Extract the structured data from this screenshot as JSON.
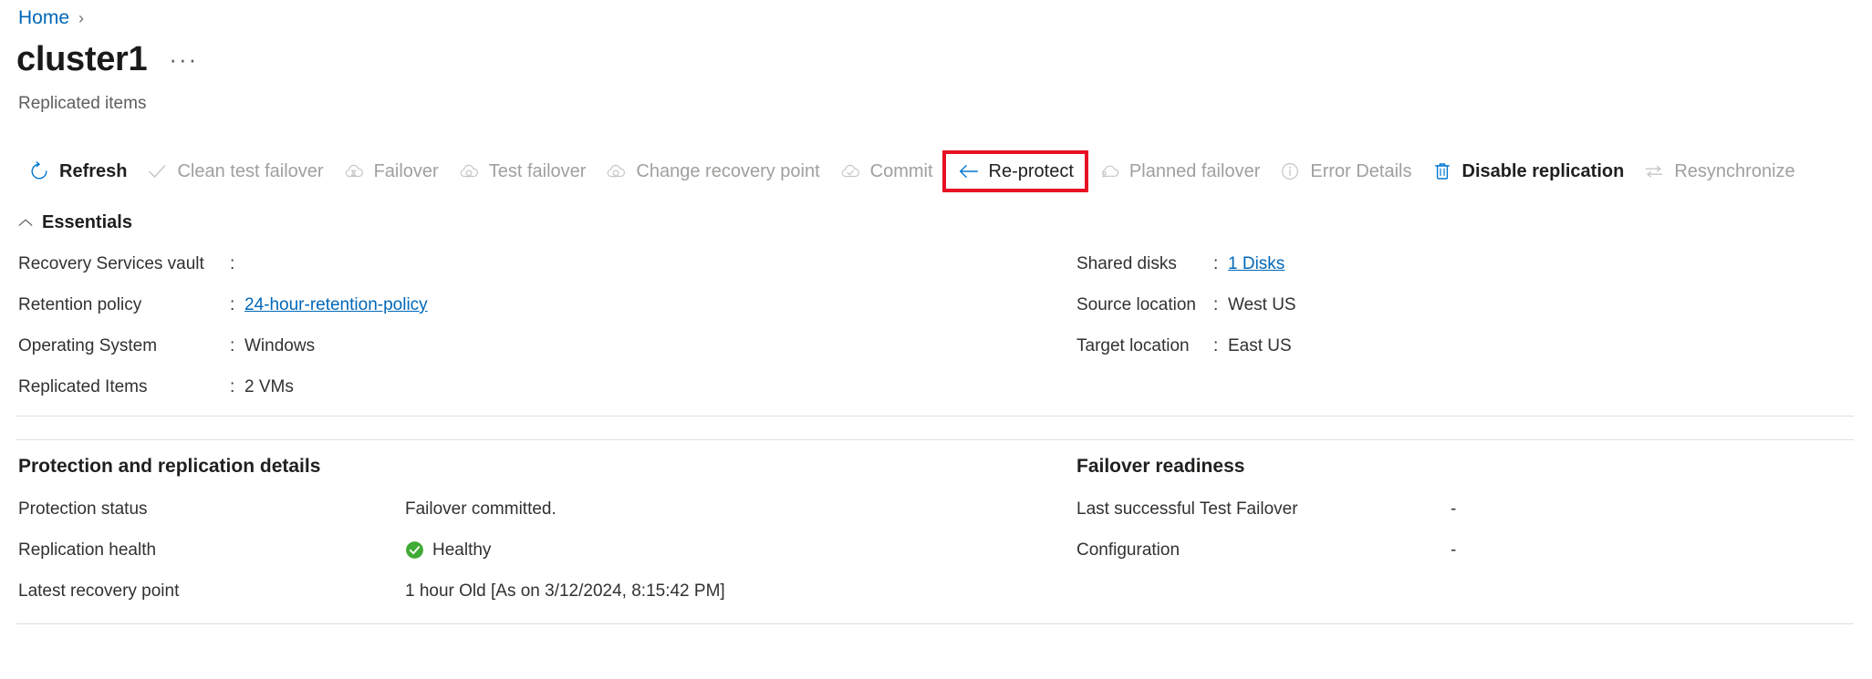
{
  "breadcrumb": {
    "home_label": "Home",
    "separator": "›"
  },
  "header": {
    "title": "cluster1",
    "ellipsis": "···",
    "subtitle": "Replicated items"
  },
  "commandbar": {
    "items": [
      {
        "label": "Refresh",
        "icon": "refresh-icon",
        "enabled": true,
        "highlighted": false
      },
      {
        "label": "Clean test failover",
        "icon": "checkmark-icon",
        "enabled": false,
        "highlighted": false
      },
      {
        "label": "Failover",
        "icon": "cloud-failover-icon",
        "enabled": false,
        "highlighted": false
      },
      {
        "label": "Test failover",
        "icon": "cloud-test-failover-icon",
        "enabled": false,
        "highlighted": false
      },
      {
        "label": "Change recovery point",
        "icon": "cloud-recovery-point-icon",
        "enabled": false,
        "highlighted": false
      },
      {
        "label": "Commit",
        "icon": "cloud-commit-icon",
        "enabled": false,
        "highlighted": false
      },
      {
        "label": "Re-protect",
        "icon": "arrow-left-icon",
        "enabled": true,
        "highlighted": true
      },
      {
        "label": "Planned failover",
        "icon": "cloud-planned-icon",
        "enabled": false,
        "highlighted": false
      },
      {
        "label": "Error Details",
        "icon": "info-circle-icon",
        "enabled": false,
        "highlighted": false
      },
      {
        "label": "Disable replication",
        "icon": "trash-icon",
        "enabled": true,
        "highlighted": false
      },
      {
        "label": "Resynchronize",
        "icon": "resync-arrows-icon",
        "enabled": false,
        "highlighted": false
      }
    ]
  },
  "essentials": {
    "title": "Essentials",
    "colon": ":",
    "left": [
      {
        "key": "Recovery Services vault",
        "value": "",
        "link": false
      },
      {
        "key": "Retention policy",
        "value": "24-hour-retention-policy",
        "link": true
      },
      {
        "key": "Operating System",
        "value": "Windows",
        "link": false
      },
      {
        "key": "Replicated Items",
        "value": "2 VMs",
        "link": false
      }
    ],
    "right": [
      {
        "key": "Shared disks",
        "value": "1 Disks",
        "link": true
      },
      {
        "key": "Source location",
        "value": "West US",
        "link": false
      },
      {
        "key": "Target location",
        "value": "East US",
        "link": false
      }
    ]
  },
  "protection": {
    "title": "Protection and replication details",
    "rows": [
      {
        "key": "Protection status",
        "value": "Failover committed.",
        "health": false
      },
      {
        "key": "Replication health",
        "value": "Healthy",
        "health": true
      },
      {
        "key": "Latest recovery point",
        "value": "1 hour Old [As on 3/12/2024, 8:15:42 PM]",
        "health": false
      }
    ]
  },
  "readiness": {
    "title": "Failover readiness",
    "rows": [
      {
        "key": "Last successful Test Failover",
        "value": "-"
      },
      {
        "key": "Configuration",
        "value": "-"
      }
    ]
  },
  "colors": {
    "link": "#0067b8",
    "highlight_border": "#e81123",
    "healthy_green": "#3faa35",
    "disabled_text": "#a19f9d",
    "accent_blue": "#0078d4"
  }
}
